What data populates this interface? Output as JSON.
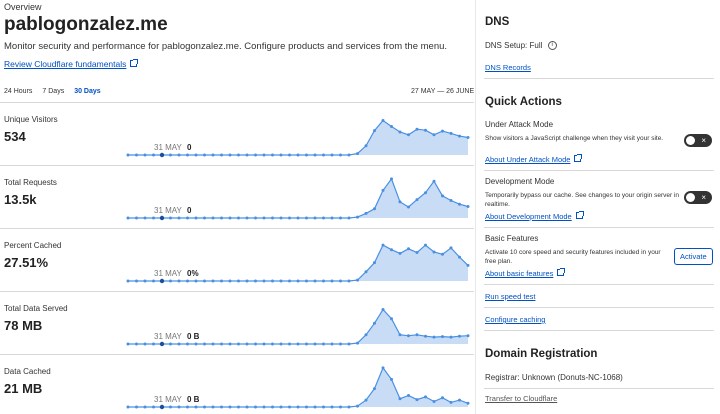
{
  "header": {
    "overview": "Overview",
    "domain": "pablogonzalez.me",
    "subtitle": "Monitor security and performance for pablogonzalez.me. Configure products and services from the menu.",
    "review_link": "Review Cloudflare fundamentals"
  },
  "range": {
    "options": [
      "24 Hours",
      "7 Days",
      "30 Days"
    ],
    "active": "30 Days",
    "date_range": "27 MAY — 26 JUNE"
  },
  "metrics": [
    {
      "label": "Unique Visitors",
      "value": "534",
      "hover_date": "31 MAY",
      "hover_value": "0",
      "series": [
        0,
        0,
        0,
        0,
        0,
        0,
        0,
        0,
        0,
        0,
        0,
        0,
        0,
        0,
        0,
        0,
        0,
        0,
        0,
        0,
        0,
        0,
        0,
        0,
        0,
        0,
        0,
        3,
        20,
        53,
        75,
        62,
        50,
        44,
        56,
        54,
        44,
        52,
        47,
        41,
        38
      ]
    },
    {
      "label": "Total Requests",
      "value": "13.5k",
      "hover_date": "31 MAY",
      "hover_value": "0",
      "series": [
        0,
        0,
        0,
        0,
        0,
        0,
        0,
        0,
        0,
        0,
        0,
        0,
        0,
        0,
        0,
        0,
        0,
        0,
        0,
        0,
        0,
        0,
        0,
        0,
        0,
        0,
        0,
        2,
        10,
        20,
        60,
        85,
        35,
        24,
        40,
        55,
        80,
        48,
        38,
        30,
        25
      ]
    },
    {
      "label": "Percent Cached",
      "value": "27.51%",
      "hover_date": "31 MAY",
      "hover_value": "0%",
      "series": [
        0,
        0,
        0,
        0,
        0,
        0,
        0,
        0,
        0,
        0,
        0,
        0,
        0,
        0,
        0,
        0,
        0,
        0,
        0,
        0,
        0,
        0,
        0,
        0,
        0,
        0,
        0,
        2,
        20,
        40,
        78,
        68,
        60,
        70,
        62,
        78,
        63,
        58,
        72,
        52,
        34
      ]
    },
    {
      "label": "Total Data Served",
      "value": "78 MB",
      "hover_date": "31 MAY",
      "hover_value": "0 B",
      "series": [
        0,
        0,
        0,
        0,
        0,
        0,
        0,
        0,
        0,
        0,
        0,
        0,
        0,
        0,
        0,
        0,
        0,
        0,
        0,
        0,
        0,
        0,
        0,
        0,
        0,
        0,
        0,
        2,
        20,
        45,
        75,
        55,
        20,
        18,
        20,
        17,
        15,
        16,
        15,
        17,
        18
      ]
    },
    {
      "label": "Data Cached",
      "value": "21 MB",
      "hover_date": "31 MAY",
      "hover_value": "0 B",
      "series": [
        0,
        0,
        0,
        0,
        0,
        0,
        0,
        0,
        0,
        0,
        0,
        0,
        0,
        0,
        0,
        0,
        0,
        0,
        0,
        0,
        0,
        0,
        0,
        0,
        0,
        0,
        0,
        2,
        15,
        40,
        85,
        60,
        18,
        25,
        16,
        22,
        12,
        20,
        10,
        15,
        8
      ]
    }
  ],
  "chart_color": "#4a90e2",
  "dns": {
    "title": "DNS",
    "setup_label": "DNS Setup:",
    "setup_value": "Full",
    "records_link": "DNS Records"
  },
  "quick_actions": {
    "title": "Quick Actions",
    "under_attack": {
      "title": "Under Attack Mode",
      "desc": "Show visitors a JavaScript challenge when they visit your site.",
      "link": "About Under Attack Mode"
    },
    "dev_mode": {
      "title": "Development Mode",
      "desc": "Temporarily bypass our cache. See changes to your origin server in realtime.",
      "link": "About Development Mode"
    },
    "basic": {
      "title": "Basic Features",
      "desc": "Activate 10 core speed and security features included in your free plan.",
      "link": "About basic features",
      "button": "Activate"
    },
    "speed_test": "Run speed test",
    "caching": "Configure caching"
  },
  "domain_registration": {
    "title": "Domain Registration",
    "registrar": "Registrar: Unknown (Donuts-NC-1068)",
    "transfer": "Transfer to Cloudflare"
  }
}
